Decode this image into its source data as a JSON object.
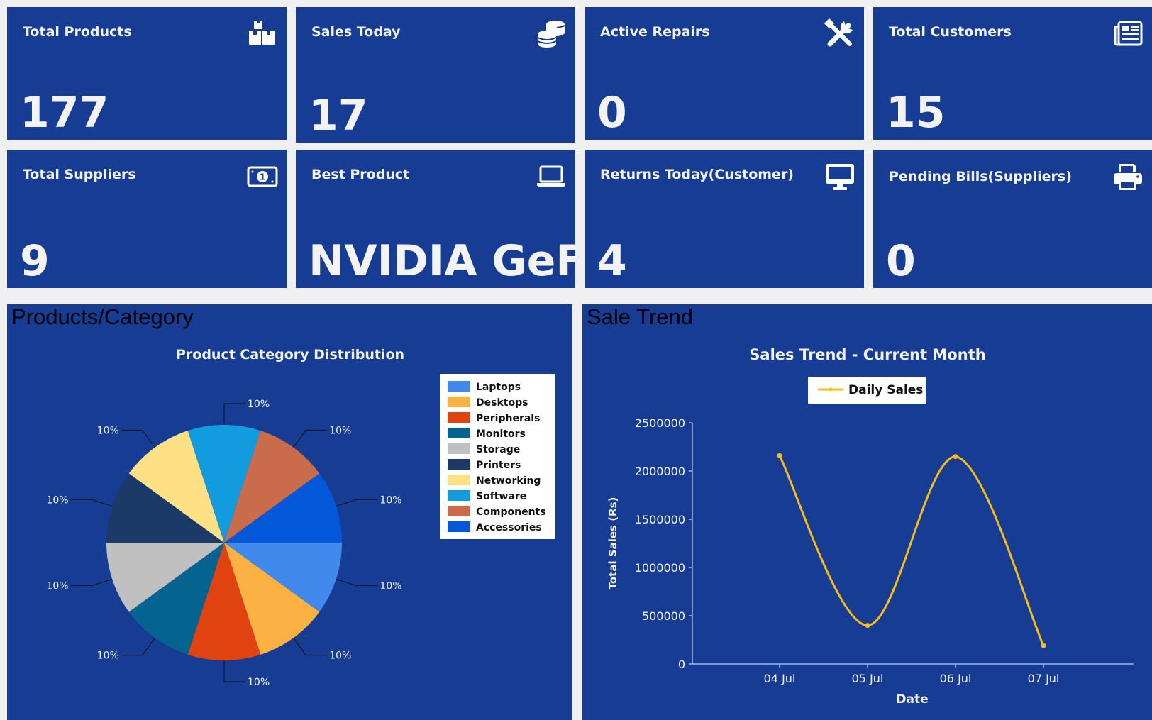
{
  "cards": [
    {
      "title": "Total Products",
      "value": "177",
      "icon": "boxes-icon"
    },
    {
      "title": "Sales Today",
      "value": "17",
      "icon": "coins-icon"
    },
    {
      "title": "Active Repairs",
      "value": "0",
      "icon": "tools-icon"
    },
    {
      "title": "Total Customers",
      "value": "15",
      "icon": "newspaper-icon"
    },
    {
      "title": "Total Suppliers",
      "value": "9",
      "icon": "money-bill-icon"
    },
    {
      "title": "Best Product",
      "value": "NVIDIA GeForce",
      "icon": "laptop-icon"
    },
    {
      "title": "Returns Today(Customer)",
      "value": "4",
      "icon": "desktop-icon"
    },
    {
      "title": "Pending Bills(Suppliers)",
      "value": "0",
      "icon": "printer-icon"
    }
  ],
  "panels": {
    "left_heading": "Products/Category",
    "right_heading": "Sale Trend"
  },
  "chart_data": [
    {
      "type": "pie",
      "title": "Product Category Distribution",
      "categories": [
        "Laptops",
        "Desktops",
        "Peripherals",
        "Monitors",
        "Storage",
        "Printers",
        "Networking",
        "Software",
        "Components",
        "Accessories"
      ],
      "values": [
        10,
        10,
        10,
        10,
        10,
        10,
        10,
        10,
        10,
        10
      ],
      "slice_labels": [
        "10%",
        "10%",
        "10%",
        "10%",
        "10%",
        "10%",
        "10%",
        "10%",
        "10%",
        "10%"
      ],
      "colors": [
        "#4289ee",
        "#fbb242",
        "#e0430f",
        "#05638f",
        "#c0c0c0",
        "#1b3a68",
        "#ffe185",
        "#129bde",
        "#c96c4c",
        "#0258d8"
      ],
      "legend_position": "right"
    },
    {
      "type": "line",
      "title": "Sales Trend - Current Month",
      "x": [
        "04 Jul",
        "05 Jul",
        "06 Jul",
        "07 Jul"
      ],
      "series": [
        {
          "name": "Daily Sales",
          "values": [
            2160000,
            400000,
            2150000,
            190000
          ],
          "color": "#f8bc17"
        }
      ],
      "xlabel": "Date",
      "ylabel": "Total Sales (Rs)",
      "ylim": [
        0,
        2500000
      ],
      "yticks": [
        "0",
        "500000",
        "1000000",
        "1500000",
        "2000000",
        "2500000"
      ],
      "legend_position": "top"
    }
  ]
}
